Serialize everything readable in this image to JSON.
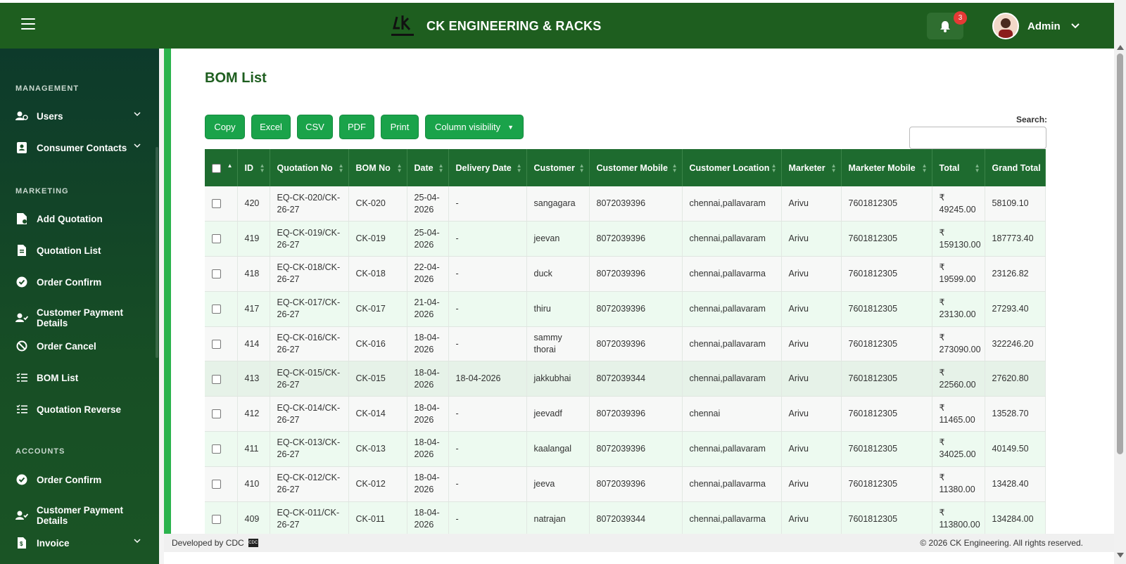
{
  "header": {
    "brand": "CK ENGINEERING & RACKS",
    "notification_count": "3",
    "user_name": "Admin"
  },
  "sidebar": {
    "sections": [
      {
        "title": "MANAGEMENT"
      },
      {
        "title": "MARKETING"
      },
      {
        "title": "ACCOUNTS"
      }
    ],
    "items": [
      {
        "label": "Users"
      },
      {
        "label": "Consumer Contacts"
      },
      {
        "label": "Add Quotation"
      },
      {
        "label": "Quotation List"
      },
      {
        "label": "Order Confirm"
      },
      {
        "label": "Customer Payment Details"
      },
      {
        "label": "Order Cancel"
      },
      {
        "label": "BOM List"
      },
      {
        "label": "Quotation Reverse"
      },
      {
        "label": "Order Confirm"
      },
      {
        "label": "Customer Payment Details"
      },
      {
        "label": "Invoice"
      }
    ]
  },
  "main": {
    "title": "BOM List",
    "buttons": {
      "copy": "Copy",
      "excel": "Excel",
      "csv": "CSV",
      "pdf": "PDF",
      "print": "Print",
      "column_visibility": "Column visibility"
    },
    "search_label": "Search:"
  },
  "table": {
    "headers": [
      "ID",
      "Quotation No",
      "BOM No",
      "Date",
      "Delivery Date",
      "Customer",
      "Customer Mobile",
      "Customer Location",
      "Marketer",
      "Marketer Mobile",
      "Total",
      "Grand Total"
    ],
    "rows": [
      {
        "id": "420",
        "quotation_no": "EQ-CK-020/CK-26-27",
        "bom_no": "CK-020",
        "date": "25-04-2026",
        "delivery_date": "-",
        "customer": "sangagara",
        "customer_mobile": "8072039396",
        "location": "chennai,pallavaram",
        "marketer": "Arivu",
        "marketer_mobile": "7601812305",
        "total": "₹ 49245.00",
        "grand_total": "58109.10"
      },
      {
        "id": "419",
        "quotation_no": "EQ-CK-019/CK-26-27",
        "bom_no": "CK-019",
        "date": "25-04-2026",
        "delivery_date": "-",
        "customer": "jeevan",
        "customer_mobile": "8072039396",
        "location": "chennai,pallavaram",
        "marketer": "Arivu",
        "marketer_mobile": "7601812305",
        "total": "₹ 159130.00",
        "grand_total": "187773.40"
      },
      {
        "id": "418",
        "quotation_no": "EQ-CK-018/CK-26-27",
        "bom_no": "CK-018",
        "date": "22-04-2026",
        "delivery_date": "-",
        "customer": "duck",
        "customer_mobile": "8072039396",
        "location": "chennai,pallavarma",
        "marketer": "Arivu",
        "marketer_mobile": "7601812305",
        "total": "₹ 19599.00",
        "grand_total": "23126.82"
      },
      {
        "id": "417",
        "quotation_no": "EQ-CK-017/CK-26-27",
        "bom_no": "CK-017",
        "date": "21-04-2026",
        "delivery_date": "-",
        "customer": "thiru",
        "customer_mobile": "8072039396",
        "location": "chennai,pallavaram",
        "marketer": "Arivu",
        "marketer_mobile": "7601812305",
        "total": "₹ 23130.00",
        "grand_total": "27293.40"
      },
      {
        "id": "414",
        "quotation_no": "EQ-CK-016/CK-26-27",
        "bom_no": "CK-016",
        "date": "18-04-2026",
        "delivery_date": "-",
        "customer": "sammy thorai",
        "customer_mobile": "8072039396",
        "location": "chennai,pallavaram",
        "marketer": "Arivu",
        "marketer_mobile": "7601812305",
        "total": "₹ 273090.00",
        "grand_total": "322246.20"
      },
      {
        "id": "413",
        "quotation_no": "EQ-CK-015/CK-26-27",
        "bom_no": "CK-015",
        "date": "18-04-2026",
        "delivery_date": "18-04-2026",
        "customer": "jakkubhai",
        "customer_mobile": "8072039344",
        "location": "chennai,pallavaram",
        "marketer": "Arivu",
        "marketer_mobile": "7601812305",
        "total": "₹ 22560.00",
        "grand_total": "27620.80"
      },
      {
        "id": "412",
        "quotation_no": "EQ-CK-014/CK-26-27",
        "bom_no": "CK-014",
        "date": "18-04-2026",
        "delivery_date": "-",
        "customer": "jeevadf",
        "customer_mobile": "8072039396",
        "location": "chennai",
        "marketer": "Arivu",
        "marketer_mobile": "7601812305",
        "total": "₹ 11465.00",
        "grand_total": "13528.70"
      },
      {
        "id": "411",
        "quotation_no": "EQ-CK-013/CK-26-27",
        "bom_no": "CK-013",
        "date": "18-04-2026",
        "delivery_date": "-",
        "customer": "kaalangal",
        "customer_mobile": "8072039396",
        "location": "chennai,pallavaram",
        "marketer": "Arivu",
        "marketer_mobile": "7601812305",
        "total": "₹ 34025.00",
        "grand_total": "40149.50"
      },
      {
        "id": "410",
        "quotation_no": "EQ-CK-012/CK-26-27",
        "bom_no": "CK-012",
        "date": "18-04-2026",
        "delivery_date": "-",
        "customer": "jeeva",
        "customer_mobile": "8072039396",
        "location": "chennai,pallavarma",
        "marketer": "Arivu",
        "marketer_mobile": "7601812305",
        "total": "₹ 11380.00",
        "grand_total": "13428.40"
      },
      {
        "id": "409",
        "quotation_no": "EQ-CK-011/CK-26-27",
        "bom_no": "CK-011",
        "date": "18-04-2026",
        "delivery_date": "-",
        "customer": "natrajan",
        "customer_mobile": "8072039344",
        "location": "chennai,pallavarma",
        "marketer": "Arivu",
        "marketer_mobile": "7601812305",
        "total": "₹ 113800.00",
        "grand_total": "134284.00"
      }
    ]
  },
  "footer": {
    "developed_by": "Developed by CDC",
    "copyright": "© 2026 CK Engineering. All rights reserved."
  }
}
